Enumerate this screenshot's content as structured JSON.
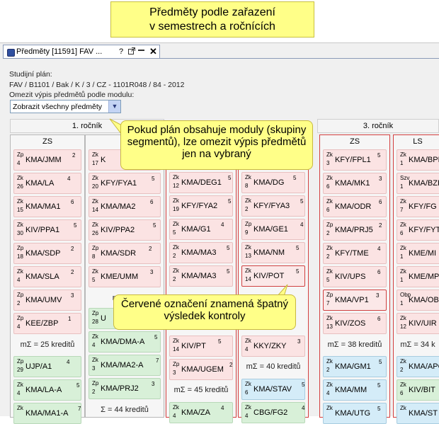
{
  "header_note": {
    "line1": "Předměty podle zařazení",
    "line2": "v semestrech a ročnících"
  },
  "tab": {
    "title": "Předměty  [11591] FAV ...",
    "help": "?",
    "close": "✕"
  },
  "study_plan": {
    "label": "Studijní plán:",
    "value": "FAV / B1101 / Bak / K / 3 / CZ - 1101R048 / 84 - 2012",
    "filter_label": "Omezit výpis předmětů podle modulu:",
    "filter_value": "Zobrazit všechny předměty"
  },
  "years": [
    "1. ročník",
    "3. ročník"
  ],
  "columns": [
    {
      "header": "ZS",
      "cards": [
        {
          "type": "Zp",
          "num": "4",
          "code": "KMA/JMM",
          "credits": "2",
          "style": "pink"
        },
        {
          "type": "Zk",
          "num": "26",
          "code": "KMA/LA",
          "credits": "4",
          "style": "pink"
        },
        {
          "type": "Zk",
          "num": "15",
          "code": "KMA/MA1",
          "credits": "6",
          "style": "pink"
        },
        {
          "type": "Zk",
          "num": "30",
          "code": "KIV/PPA1",
          "credits": "5",
          "style": "pink"
        },
        {
          "type": "Zp",
          "num": "18",
          "code": "KMA/SDP",
          "credits": "2",
          "style": "pink"
        },
        {
          "type": "Zk",
          "num": "4",
          "code": "KMA/SLA",
          "credits": "2",
          "style": "pink"
        },
        {
          "type": "Zp",
          "num": "2",
          "code": "KMA/UMV",
          "credits": "3",
          "style": "pink"
        },
        {
          "type": "Zp",
          "num": "4",
          "code": "KEE/ZBP",
          "credits": "1",
          "style": "pink"
        }
      ],
      "sum": "mΣ = 25 kreditů",
      "extra": [
        {
          "type": "Zp",
          "num": "29",
          "code": "UJP/A1",
          "credits": "4",
          "style": "green"
        },
        {
          "type": "Zk",
          "num": "4",
          "code": "KMA/LA-A",
          "credits": "5",
          "style": "green"
        },
        {
          "type": "Zk",
          "num": "",
          "code": "KMA/MA1-A",
          "credits": "7",
          "style": "green"
        }
      ]
    },
    {
      "header": "",
      "cards": [
        {
          "type": "Zk",
          "num": "17",
          "code": "K",
          "credits": "",
          "style": "pink"
        },
        {
          "type": "Zk",
          "num": "20",
          "code": "KFY/FYA1",
          "credits": "5",
          "style": "pink"
        },
        {
          "type": "Zk",
          "num": "14",
          "code": "KMA/MA2",
          "credits": "6",
          "style": "pink"
        },
        {
          "type": "Zk",
          "num": "26",
          "code": "KIV/PPA2",
          "credits": "5",
          "style": "pink"
        },
        {
          "type": "Zp",
          "num": "8",
          "code": "KMA/SDR",
          "credits": "2",
          "style": "pink"
        },
        {
          "type": "Zk",
          "num": "5",
          "code": "KME/UMM",
          "credits": "3",
          "style": "pink"
        }
      ],
      "sum": "mΣ = 2",
      "extra": [
        {
          "type": "Zp",
          "num": "28",
          "code": "U",
          "credits": "",
          "style": "green"
        },
        {
          "type": "Zk",
          "num": "4",
          "code": "KMA/DMA-A",
          "credits": "5",
          "style": "green"
        },
        {
          "type": "Zk",
          "num": "3",
          "code": "KMA/MA2-A",
          "credits": "7",
          "style": "green"
        },
        {
          "type": "Zp",
          "num": "2",
          "code": "KMA/PRJ2",
          "credits": "3",
          "style": "green"
        }
      ],
      "sum2": "Σ = 44 kreditů"
    },
    {
      "header": "",
      "cards": [
        {
          "type": "Zk",
          "num": "12",
          "code": "KMA/DEG1",
          "credits": "5",
          "style": "pink"
        },
        {
          "type": "Zk",
          "num": "19",
          "code": "KFY/FYA2",
          "credits": "5",
          "style": "pink"
        },
        {
          "type": "Zk",
          "num": "5",
          "code": "KMA/G1",
          "credits": "4",
          "style": "pink"
        },
        {
          "type": "Zk",
          "num": "2",
          "code": "KMA/MA3",
          "credits": "5",
          "style": "pink"
        },
        {
          "type": "Zk",
          "num": "2",
          "code": "KMA/MA3",
          "credits": "5",
          "style": "pink"
        },
        {
          "type": "Zk",
          "num": "14",
          "code": "KIV/PT",
          "credits": "5",
          "style": "pink"
        },
        {
          "type": "Zp",
          "num": "3",
          "code": "KMA/UGEM",
          "credits": "2",
          "style": "pink"
        }
      ],
      "sum": "mΣ = 45 kreditů",
      "extra": [
        {
          "type": "Zk",
          "num": "4",
          "code": "KMA/ZA",
          "credits": "4",
          "style": "green"
        }
      ]
    },
    {
      "header": "",
      "cards": [
        {
          "type": "Zk",
          "num": "8",
          "code": "KMA/DG",
          "credits": "5",
          "style": "pink"
        },
        {
          "type": "Zk",
          "num": "2",
          "code": "KFY/FYA3",
          "credits": "5",
          "style": "pink"
        },
        {
          "type": "Zp",
          "num": "9",
          "code": "KMA/GE1",
          "credits": "4",
          "style": "pink"
        },
        {
          "type": "Zk",
          "num": "13",
          "code": "KMA/NM",
          "credits": "5",
          "style": "pink"
        },
        {
          "type": "Zk",
          "num": "14",
          "code": "KIV/POT",
          "credits": "5",
          "style": "red"
        },
        {
          "type": "Zk",
          "num": "4",
          "code": "KKY/ZKY",
          "credits": "3",
          "style": "pink"
        }
      ],
      "sum": "mΣ = 40 kreditů",
      "extra": [
        {
          "type": "Zk",
          "num": "6",
          "code": "KMA/STAV",
          "credits": "5",
          "style": "blue"
        },
        {
          "type": "Zk",
          "num": "4",
          "code": "CBG/FG2",
          "credits": "4",
          "style": "green"
        }
      ]
    },
    {
      "header": "ZS",
      "cards": [
        {
          "type": "Zk",
          "num": "3",
          "code": "KFY/FPL1",
          "credits": "5",
          "style": "pink"
        },
        {
          "type": "Zk",
          "num": "6",
          "code": "KMA/MK1",
          "credits": "3",
          "style": "pink"
        },
        {
          "type": "Zk",
          "num": "6",
          "code": "KMA/ODR",
          "credits": "6",
          "style": "pink"
        },
        {
          "type": "Zp",
          "num": "2",
          "code": "KMA/PRJ5",
          "credits": "2",
          "style": "pink"
        },
        {
          "type": "Zk",
          "num": "2",
          "code": "KFY/TME",
          "credits": "4",
          "style": "pink"
        },
        {
          "type": "Zk",
          "num": "5",
          "code": "KIV/UPS",
          "credits": "6",
          "style": "pink"
        },
        {
          "type": "Zp",
          "num": "7",
          "code": "KMA/VP1",
          "credits": "3",
          "style": "red"
        },
        {
          "type": "Zk",
          "num": "13",
          "code": "KIV/ZOS",
          "credits": "6",
          "style": "pink"
        }
      ],
      "sum": "mΣ = 38 kreditů",
      "extra": [
        {
          "type": "Zk",
          "num": "2",
          "code": "KMA/GM1",
          "credits": "5",
          "style": "blue"
        },
        {
          "type": "Zk",
          "num": "4",
          "code": "KMA/MM",
          "credits": "5",
          "style": "blue"
        },
        {
          "type": "Zk",
          "num": "",
          "code": "KMA/UTG",
          "credits": "5",
          "style": "blue"
        }
      ]
    },
    {
      "header": "LS",
      "cards": [
        {
          "type": "Zk",
          "num": "1",
          "code": "KMA/BPM",
          "credits": "",
          "style": "pink"
        },
        {
          "type": "Szv",
          "num": "1",
          "code": "KMA/BZK",
          "credits": "",
          "style": "pink"
        },
        {
          "type": "Zk",
          "num": "7",
          "code": "KFY/FG",
          "credits": "",
          "style": "pink"
        },
        {
          "type": "Zk",
          "num": "6",
          "code": "KFY/FYT",
          "credits": "",
          "style": "pink"
        },
        {
          "type": "Zk",
          "num": "1",
          "code": "KME/MI",
          "credits": "",
          "style": "pink"
        },
        {
          "type": "Zk",
          "num": "1",
          "code": "KME/MP",
          "credits": "",
          "style": "pink"
        },
        {
          "type": "Obp",
          "num": "1",
          "code": "KMA/OB",
          "credits": "",
          "style": "pink"
        },
        {
          "type": "Zk",
          "num": "12",
          "code": "KIV/UIR",
          "credits": "",
          "style": "pink"
        }
      ],
      "sum": "mΣ = 34 k",
      "extra": [
        {
          "type": "Zk",
          "num": "2",
          "code": "KMA/APG",
          "credits": "",
          "style": "blue"
        },
        {
          "type": "Zk",
          "num": "6",
          "code": "KIV/BIT",
          "credits": "",
          "style": "green"
        },
        {
          "type": "Zk",
          "num": "",
          "code": "KMA/ST",
          "credits": "",
          "style": "blue"
        }
      ]
    }
  ],
  "callouts": {
    "modules": "Pokud plán obsahuje moduly (skupiny segmentů), lze omezit výpis předmětů jen na vybraný",
    "red": "Červené označení znamená špatný výsledek kontroly"
  }
}
